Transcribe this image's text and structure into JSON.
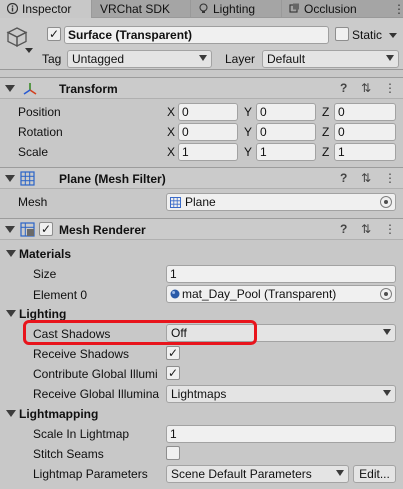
{
  "tabs": [
    {
      "label": "Inspector",
      "icon": "info-icon",
      "active": true
    },
    {
      "label": "VRChat SDK",
      "icon": null,
      "active": false
    },
    {
      "label": "Lighting",
      "icon": "bulb-icon",
      "active": false
    },
    {
      "label": "Occlusion",
      "icon": "occlusion-icon",
      "active": false
    }
  ],
  "object": {
    "name": "Surface (Transparent)",
    "static_label": "Static",
    "tag_label": "Tag",
    "tag_value": "Untagged",
    "layer_label": "Layer",
    "layer_value": "Default"
  },
  "transform": {
    "title": "Transform",
    "rows": [
      {
        "label": "Position",
        "x": "0",
        "y": "0",
        "z": "0"
      },
      {
        "label": "Rotation",
        "x": "0",
        "y": "0",
        "z": "0"
      },
      {
        "label": "Scale",
        "x": "1",
        "y": "1",
        "z": "1"
      }
    ],
    "axis": {
      "x": "X",
      "y": "Y",
      "z": "Z"
    }
  },
  "mesh_filter": {
    "title": "Plane (Mesh Filter)",
    "mesh_label": "Mesh",
    "mesh_value": "Plane"
  },
  "mesh_renderer": {
    "title": "Mesh Renderer",
    "materials_label": "Materials",
    "size_label": "Size",
    "size_value": "1",
    "element0_label": "Element 0",
    "element0_value": "mat_Day_Pool (Transparent)",
    "lighting_label": "Lighting",
    "cast_shadows_label": "Cast Shadows",
    "cast_shadows_value": "Off",
    "receive_shadows_label": "Receive Shadows",
    "contribute_gi_label": "Contribute Global Illumi",
    "receive_gi_label": "Receive Global Illumina",
    "receive_gi_value": "Lightmaps",
    "lightmapping_label": "Lightmapping",
    "scale_in_lightmap_label": "Scale In Lightmap",
    "scale_in_lightmap_value": "1",
    "stitch_seams_label": "Stitch Seams",
    "lightmap_params_label": "Lightmap Parameters",
    "lightmap_params_value": "Scene Default Parameters",
    "edit_button": "Edit..."
  },
  "icons": {
    "help": "?",
    "presets": "⇅",
    "menu": "⋮",
    "check": "✓"
  },
  "colors": {
    "highlight": "#e8141c",
    "panel": "#c8c8c8",
    "tab_bar": "#a5a5a5"
  }
}
